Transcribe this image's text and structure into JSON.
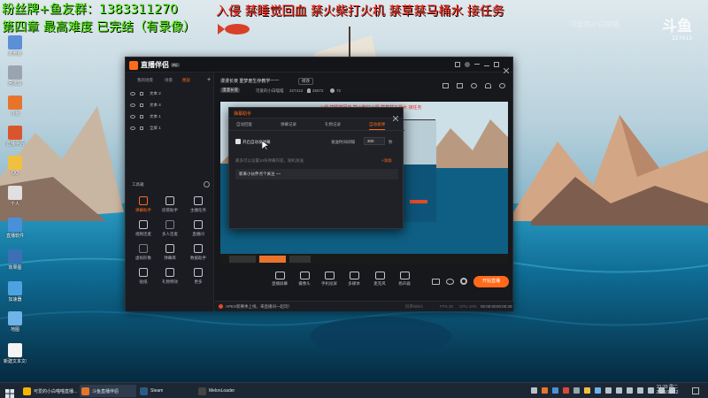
{
  "overlay": {
    "line1_left": "粉丝牌+鱼友群：1383311270",
    "line1_right": "入侵  禁睡觉回血  禁火柴打火机  禁草禁马桶水    接任务",
    "line2": "第四章  最高难度  已完结（有录像）"
  },
  "watermark": {
    "logo": "斗鱼",
    "room": "227413",
    "username": "可爱的小白喵喵"
  },
  "desktop_icons": [
    {
      "label": "此电脑",
      "color": "#5b8fd6"
    },
    {
      "label": "回收站",
      "color": "#9aa4b0"
    },
    {
      "label": "斗鱼",
      "color": "#e8742b"
    },
    {
      "label": "直播伴侣",
      "color": "#d9562c"
    },
    {
      "label": "QQ",
      "color": "#f0c040"
    },
    {
      "label": "个人",
      "color": "#e0e0e0"
    },
    {
      "label": "直播软件",
      "color": "#4a90d9"
    },
    {
      "label": "效果图",
      "color": "#3b6fb6"
    },
    {
      "label": "加速器",
      "color": "#4da3e0"
    },
    {
      "label": "地图",
      "color": "#6fb3e8"
    },
    {
      "label": "新建文本文档",
      "color": "#f4f4f4"
    }
  ],
  "app": {
    "logo": "直播伴侣",
    "logo_badge": "PC",
    "sidebar_tabs": [
      "我的场景",
      "场景",
      "图层"
    ],
    "active_tab_index": 2,
    "layers": [
      "文本 2",
      "文本 4",
      "文本 1",
      "全屏 1"
    ],
    "toolbox_title": "工具箱",
    "tools": [
      {
        "label": "弹幕助手",
        "color": "#ff6a1a"
      },
      {
        "label": "房管助手",
        "color": "#c4c7ce"
      },
      {
        "label": "主播任务",
        "color": "#c4c7ce"
      },
      {
        "label": "视频连麦",
        "color": "#c4c7ce"
      },
      {
        "label": "多人连麦",
        "color": "#7a7d84"
      },
      {
        "label": "直播间",
        "color": "#c4c7ce"
      },
      {
        "label": "虚拟形象",
        "color": "#7a7d84"
      },
      {
        "label": "弹幕库",
        "color": "#c4c7ce"
      },
      {
        "label": "数据助手",
        "color": "#c4c7ce"
      },
      {
        "label": "贴纸",
        "color": "#c4c7ce"
      },
      {
        "label": "礼物特效",
        "color": "#c4c7ce"
      },
      {
        "label": "更多",
        "color": "#c4c7ce"
      }
    ],
    "stream_title": "漫漫长夜   噩梦度生存教学一一",
    "edit_label": "修改",
    "category_tag": "漫漫长夜",
    "streamer_name": "可爱的小白喵喵",
    "room_id": "227413",
    "hot": "25072",
    "fans": "72",
    "notice": "APEX新赛季上线，来直播间一起玩！",
    "bottom_bar": [
      "直播屏幕",
      "摄像头",
      "手机投屏",
      "多媒体",
      "麦克风",
      "扬声器"
    ],
    "start_button": "开始直播",
    "status": {
      "bitrate": "码率0kb/s",
      "fps": "FPS 30",
      "cpu": "CPU 10%",
      "time1": "00:00:00",
      "time2": "00:00:29"
    }
  },
  "dialog": {
    "title": "弹幕助手",
    "tabs": [
      "自动回复",
      "弹幕记录",
      "礼物记录",
      "自动发弹"
    ],
    "active_tab_index": 3,
    "checkbox_label": "开启自动发弹幕",
    "checkbox_checked": true,
    "interval_label": "发送时间间隔",
    "interval_value": "300",
    "interval_unit": "秒",
    "hint": "最多可以设置10条弹幕内容，随机发送",
    "add_link": "+添加",
    "message": "新来小伙伴点个关注 ~~"
  },
  "taskbar": {
    "items": [
      {
        "label": "可爱的小白喵喵直播...",
        "color": "#f4b400"
      },
      {
        "label": "斗鱼直播伴侣",
        "color": "#e8742b"
      },
      {
        "label": "Steam",
        "color": "#2b5b84"
      },
      {
        "label": "MelonLoader",
        "color": "#444"
      }
    ],
    "time": "21:33",
    "weekday": "周二",
    "date": "2021/10/12"
  },
  "colors": {
    "accent": "#ff6a1a",
    "overlay_green": "#49f000",
    "overlay_red": "#ff2a1a"
  }
}
